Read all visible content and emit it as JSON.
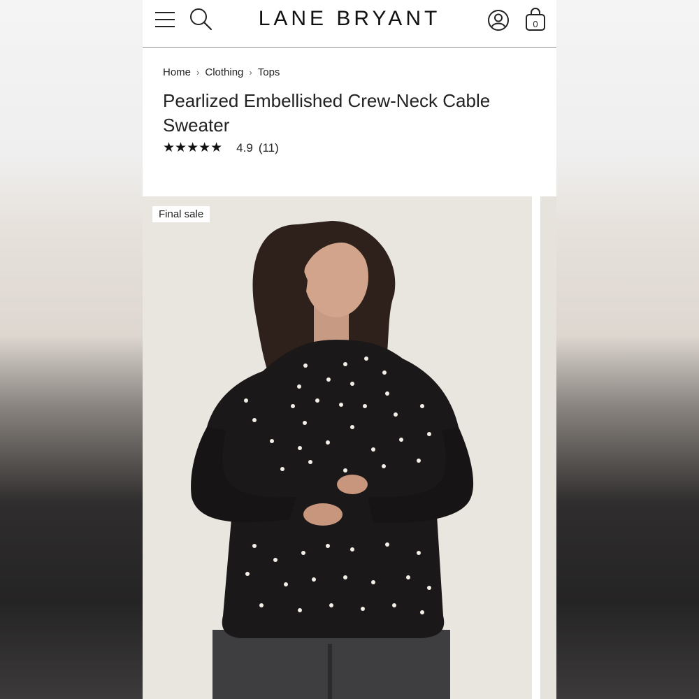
{
  "header": {
    "brand": "LANE BRYANT",
    "icons": {
      "menu": "hamburger-menu-icon",
      "search": "search-icon",
      "account": "user-account-icon",
      "bag": "shopping-bag-icon"
    },
    "bag_count": "0"
  },
  "breadcrumb": [
    "Home",
    "Clothing",
    "Tops"
  ],
  "breadcrumb_separator": "›",
  "product": {
    "title": "Pearlized Embellished Crew-Neck Cable Sweater",
    "stars": "★★★★★",
    "rating": "4.9",
    "review_count": "(11)",
    "badge": "Final sale"
  },
  "colors": {
    "text": "#222222",
    "divider": "#8d8d8d",
    "photo_bg": "#e9e5df",
    "sweater": "#1a1818"
  }
}
